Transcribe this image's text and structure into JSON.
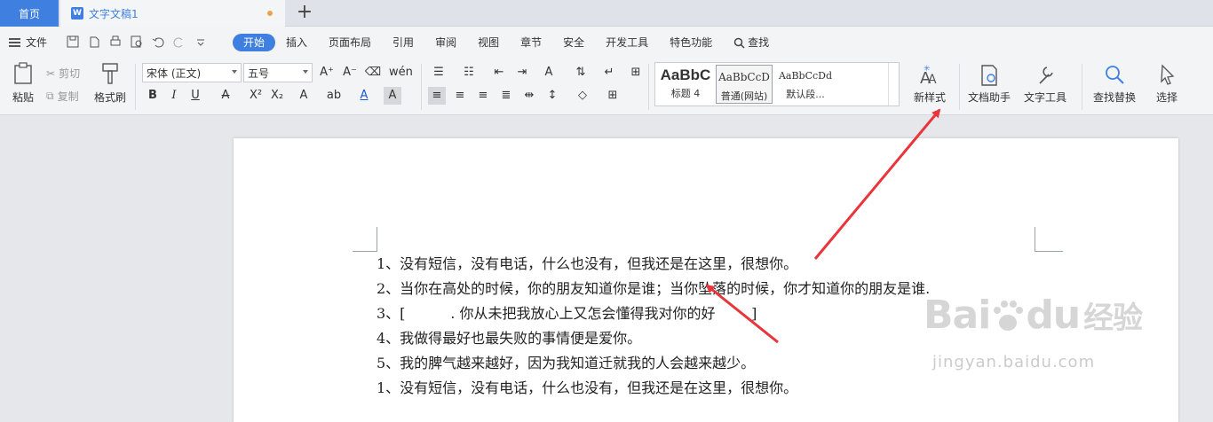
{
  "tabbar": {
    "home": "首页",
    "doc_title": "文字文稿1",
    "doc_icon": "W",
    "new_tab": "+"
  },
  "menubar": {
    "file": "文件",
    "tabs": [
      "开始",
      "插入",
      "页面布局",
      "引用",
      "审阅",
      "视图",
      "章节",
      "安全",
      "开发工具",
      "特色功能"
    ],
    "search": "查找"
  },
  "ribbon": {
    "paste": "粘贴",
    "cut": "剪切",
    "copy": "复制",
    "format_painter": "格式刷",
    "font": "宋体 (正文)",
    "size": "五号",
    "font_grow": "A⁺",
    "font_shrink": "A⁻",
    "styles": [
      {
        "preview": "AaBbC",
        "name": "标题 4"
      },
      {
        "preview": "AaBbCcD",
        "name": "普通(网站)"
      },
      {
        "preview": "AaBbCcDd",
        "name": "默认段..."
      }
    ],
    "new_style": "新样式",
    "doc_helper": "文档助手",
    "text_tools": "文字工具",
    "find_replace": "查找替换",
    "select": "选择"
  },
  "document": {
    "lines": [
      "1、没有短信，没有电话，什么也没有，但我还是在这里，很想你。",
      "2、当你在高处的时候，你的朋友知道你是谁；当你坠落的时候，你才知道你的朋友是谁.",
      "3、[          . 你从未把我放心上又怎会懂得我对你的好        ]",
      "4、我做得最好也最失败的事情便是爱你。",
      "5、我的脾气越来越好，因为我知道迁就我的人会越来越少。",
      "1、没有短信，没有电话，什么也没有，但我还是在这里，很想你。"
    ]
  },
  "watermark": {
    "brand": "Bai",
    "brand2": "du",
    "cn": "经验",
    "url": "jingyan.baidu.com"
  },
  "colors": {
    "accent": "#3e7fe0",
    "arrow": "#e8343a",
    "font_color_a": "#1a56d6"
  }
}
